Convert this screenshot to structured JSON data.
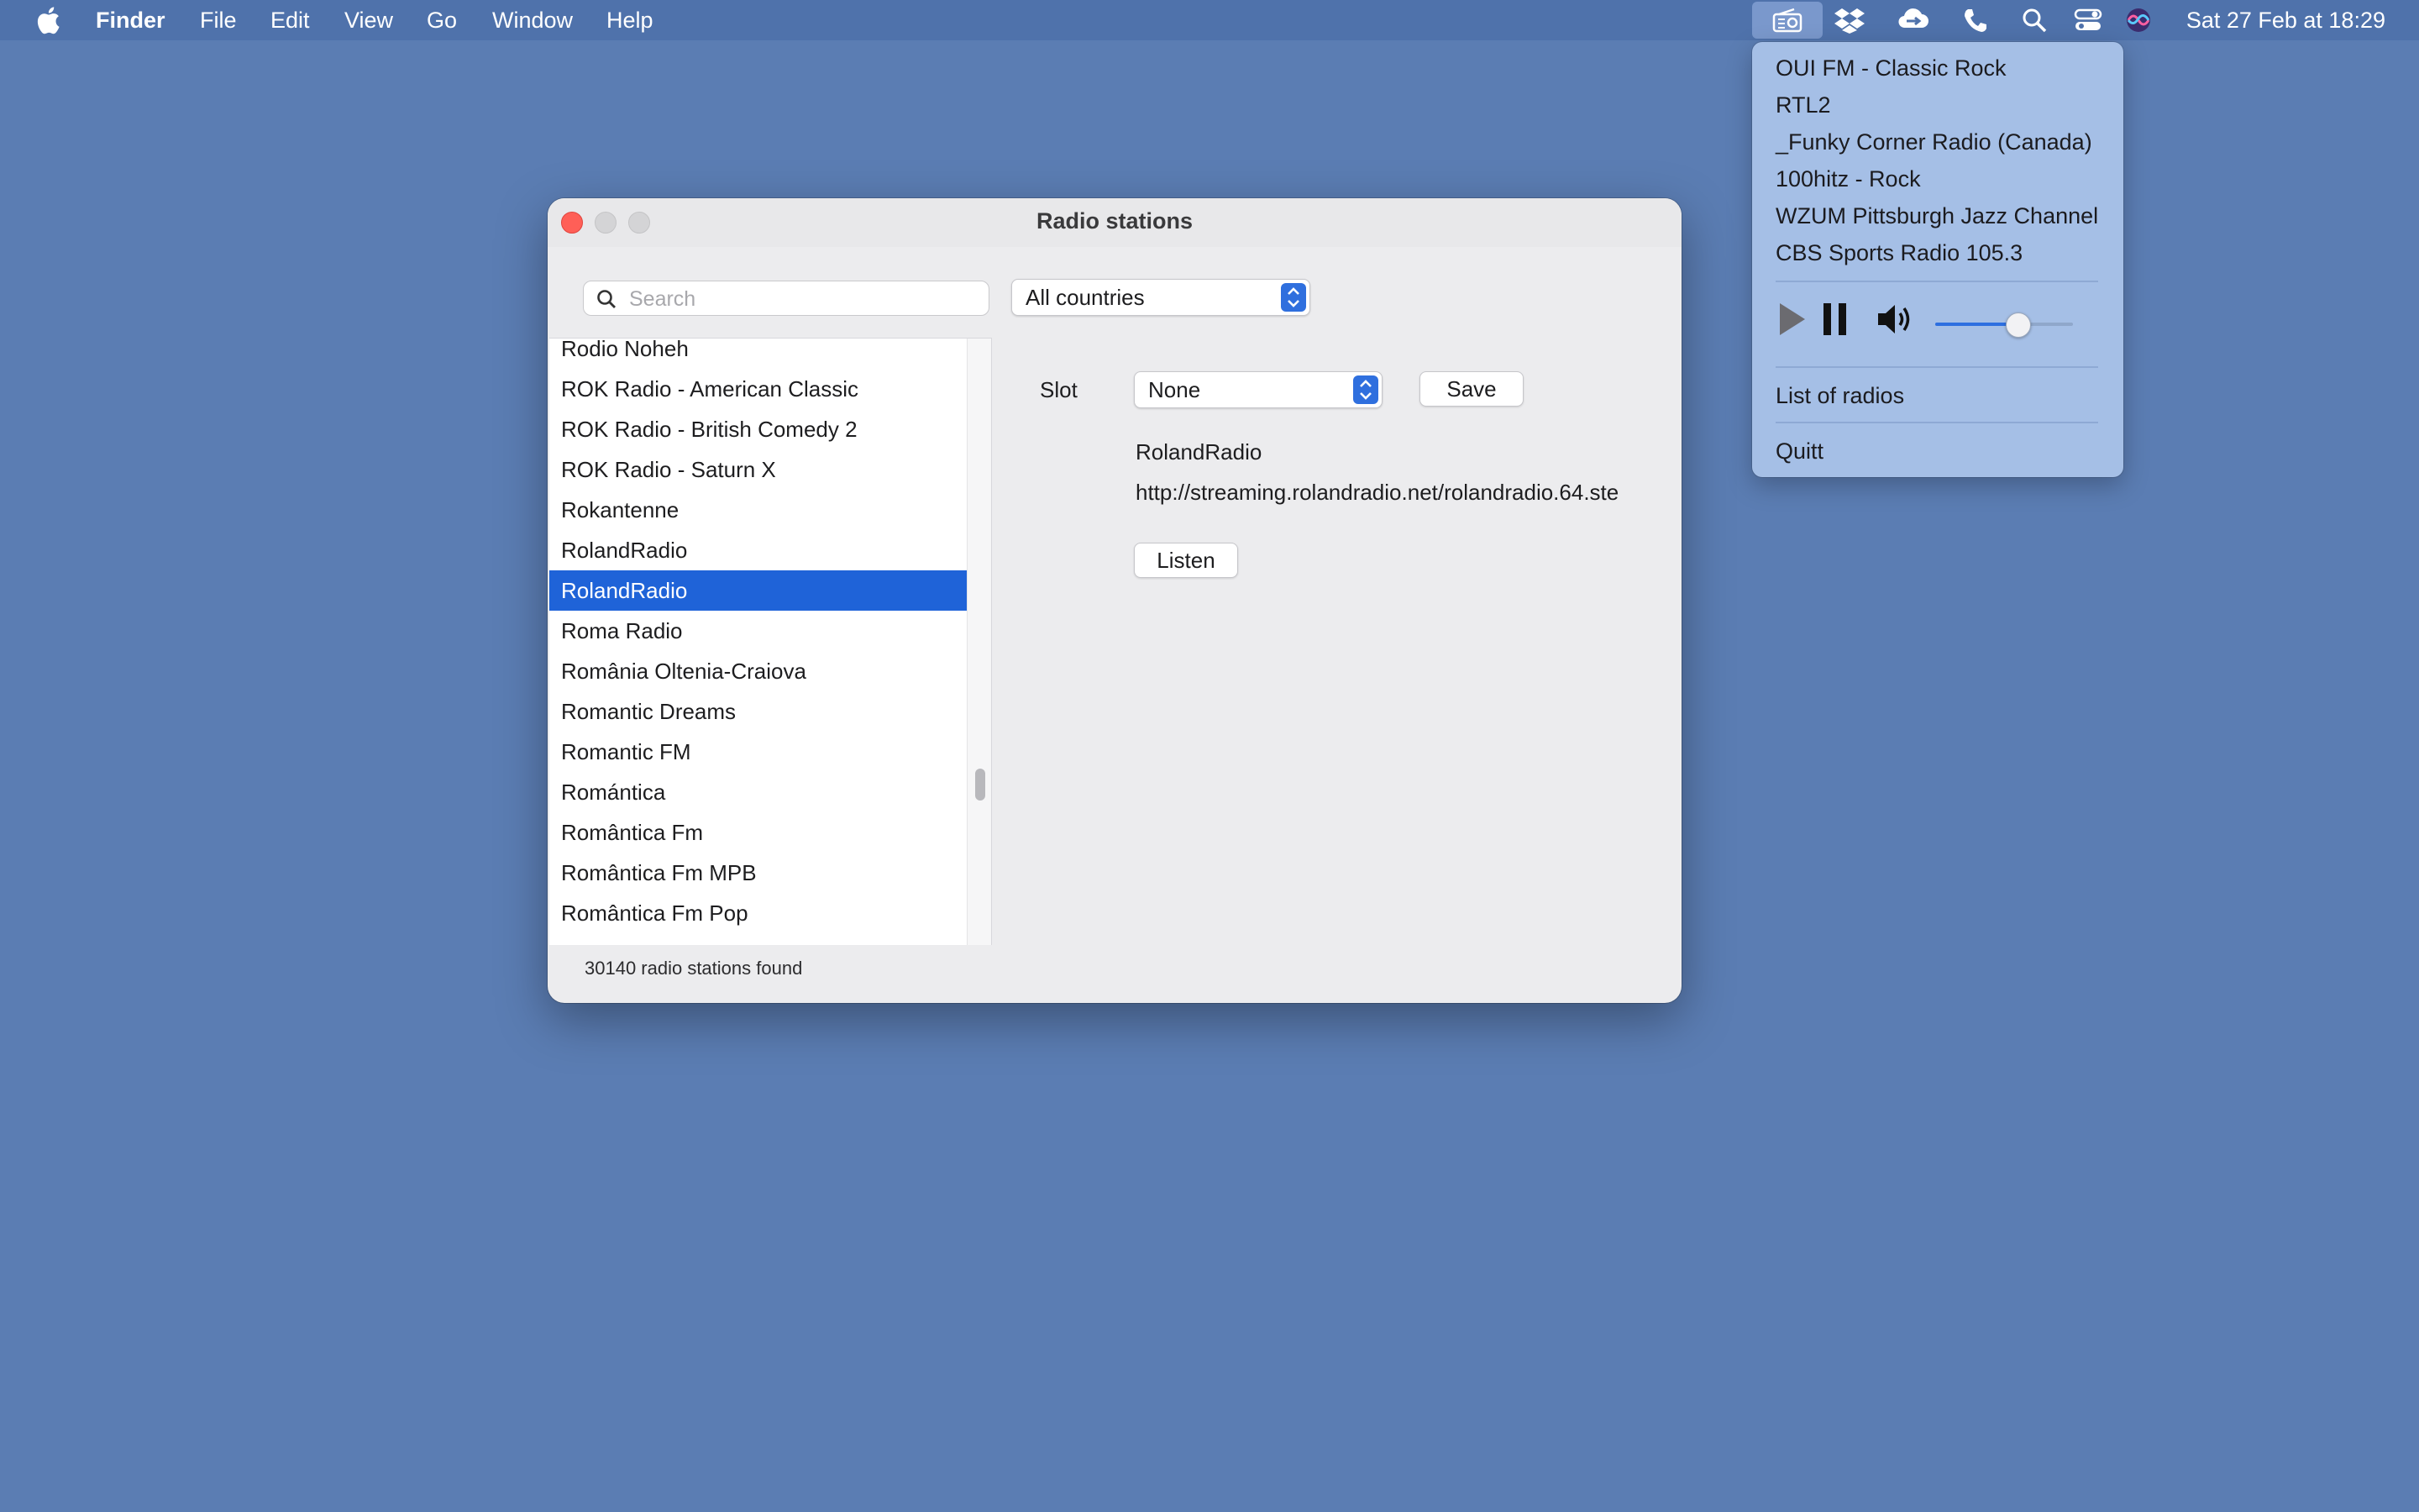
{
  "menubar": {
    "items": [
      "Finder",
      "File",
      "Edit",
      "View",
      "Go",
      "Window",
      "Help"
    ],
    "status_icons": [
      "radio-icon",
      "dropbox-icon",
      "cloud-sync-icon",
      "phone-icon",
      "spotlight-search-icon",
      "control-center-icon",
      "siri-icon"
    ],
    "clock": "Sat 27 Feb at  18:29"
  },
  "window": {
    "title": "Radio stations",
    "search": {
      "placeholder": "Search",
      "value": ""
    },
    "country_filter": "All countries",
    "stations": [
      "Rodio Noheh",
      "ROK Radio - American Classic",
      "ROK Radio - British Comedy 2",
      "ROK Radio - Saturn X",
      "Rokantenne",
      "RolandRadio",
      "RolandRadio",
      "Roma Radio",
      "România Oltenia-Craiova",
      "Romantic Dreams",
      "Romantic FM",
      "Romántica",
      "Romântica Fm",
      "Romântica Fm MPB",
      "Romântica Fm Pop"
    ],
    "selected_index": 6,
    "detail": {
      "slot_label": "Slot",
      "slot_value": "None",
      "save_label": "Save",
      "station_name": "RolandRadio",
      "station_url": "http://streaming.rolandradio.net/rolandradio.64.ste",
      "listen_label": "Listen"
    },
    "status": "30140 radio stations found"
  },
  "radio_menu": {
    "favorites": [
      "OUI FM - Classic Rock",
      "RTL2",
      "_Funky Corner Radio (Canada)",
      "100hitz - Rock",
      "WZUM Pittsburgh Jazz Channel",
      "CBS Sports Radio 105.3"
    ],
    "volume": 0.6,
    "list_label": "List of radios",
    "quit_label": "Quitt"
  },
  "colors": {
    "desktop": "#5b7db3",
    "selection": "#1f63d8",
    "menu_background": "#a5bfe6",
    "accent": "#2f6fde"
  }
}
